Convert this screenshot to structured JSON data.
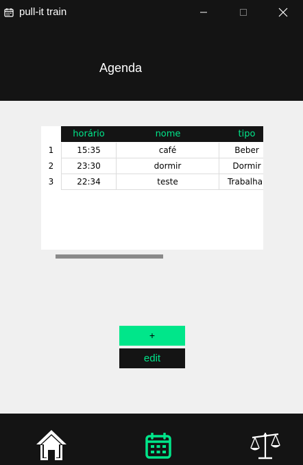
{
  "window": {
    "title": "pull-it train"
  },
  "header": {
    "title": "Agenda"
  },
  "table": {
    "columns": [
      "horário",
      "nome",
      "tipo"
    ],
    "rows": [
      {
        "index": "1",
        "horario": "15:35",
        "nome": "café",
        "tipo": "Beber"
      },
      {
        "index": "2",
        "horario": "23:30",
        "nome": "dormir",
        "tipo": "Dormir"
      },
      {
        "index": "3",
        "horario": "22:34",
        "nome": "teste",
        "tipo": "Trabalhar"
      }
    ]
  },
  "actions": {
    "add_label": "+",
    "edit_label": "edit"
  },
  "nav": {
    "items": [
      "home-icon",
      "calendar-icon",
      "balance-scale-icon"
    ]
  },
  "colors": {
    "accent": "#00e68a",
    "dark": "#141414",
    "background": "#f0f0f0"
  }
}
